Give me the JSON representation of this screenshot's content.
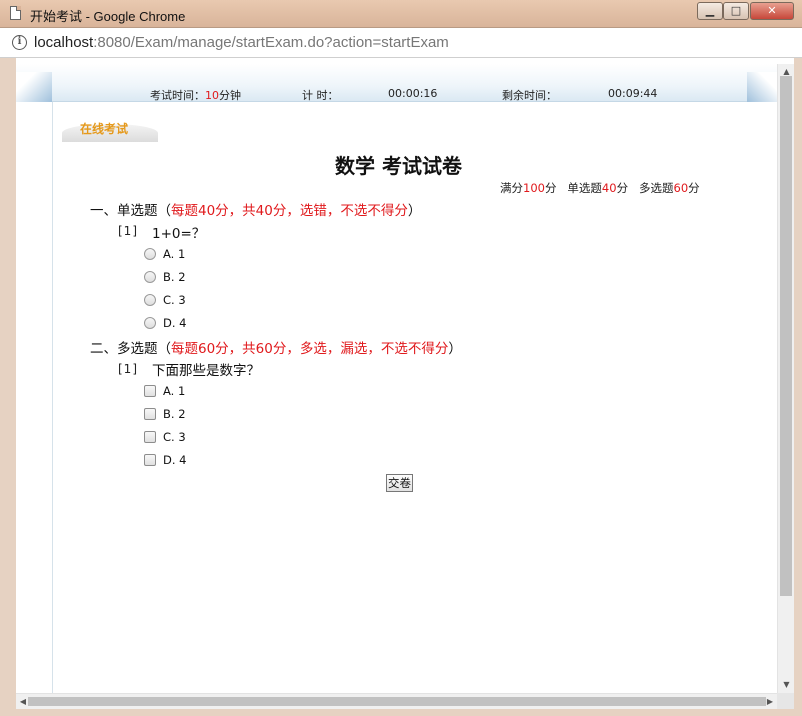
{
  "window": {
    "title": "开始考试 - Google Chrome",
    "minimize_glyph": "▁",
    "maximize_glyph": "□",
    "close_glyph": "✕"
  },
  "address": {
    "host": "localhost",
    "path": ":8080/Exam/manage/startExam.do?action=startExam",
    "info_glyph": "i"
  },
  "timer": {
    "exam_time_label": "考试时间：",
    "exam_time_value": "10",
    "exam_time_unit": "分钟",
    "elapsed_label": "计 时：",
    "elapsed_value": "00:00:16",
    "remaining_label": "剩余时间：",
    "remaining_value": "00:09:44"
  },
  "tab": {
    "label": "在线考试"
  },
  "exam": {
    "title": "数学 考试试卷",
    "score": {
      "total_label": "满分",
      "total_value": "100",
      "total_unit": "分",
      "single_label": "单选题",
      "single_value": "40",
      "single_unit": "分",
      "multi_label": "多选题",
      "multi_value": "60",
      "multi_unit": "分"
    },
    "sections": [
      {
        "heading": "一、单选题（",
        "rule": "每题40分，共40分，选错，不选不得分",
        "close": "）",
        "questions": [
          {
            "number": "[1]",
            "text": "1+0=？",
            "options": [
              "A. 1",
              "B. 2",
              "C. 3",
              "D. 4"
            ]
          }
        ]
      },
      {
        "heading": "二、多选题（",
        "rule": "每题60分，共60分，多选，漏选，不选不得分",
        "close": "）",
        "questions": [
          {
            "number": "[1]",
            "text": "下面那些是数字？",
            "options": [
              "A. 1",
              "B. 2",
              "C. 3",
              "D. 4"
            ]
          }
        ]
      }
    ],
    "submit_label": "交卷"
  },
  "colors": {
    "accent_red": "#e0191c",
    "tab_orange": "#e5991b",
    "header_blue": "#dbe9f3"
  },
  "icons": {
    "doc": "page-icon",
    "info": "info-icon",
    "scroll_up": "▲",
    "scroll_down": "▼",
    "scroll_left": "◀",
    "scroll_right": "▶"
  }
}
